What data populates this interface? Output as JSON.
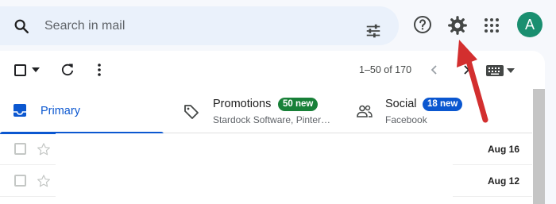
{
  "search": {
    "placeholder": "Search in mail"
  },
  "header": {
    "avatar_letter": "A"
  },
  "toolbar": {
    "pager": "1–50 of 170"
  },
  "tabs": [
    {
      "label": "Primary"
    },
    {
      "label": "Promotions",
      "badge": "50 new",
      "sub": "Stardock Software, Pinter…"
    },
    {
      "label": "Social",
      "badge": "18 new",
      "sub": "Facebook"
    }
  ],
  "rows": [
    {
      "date": "Aug 16"
    },
    {
      "date": "Aug 12"
    }
  ],
  "colors": {
    "accent": "#0b57d0",
    "promotions_badge": "#188038",
    "social_badge": "#0b57d0",
    "avatar": "#1a8f70",
    "annotation_arrow": "#d32f2f"
  },
  "icons": [
    "search-icon",
    "tune-icon",
    "help-icon",
    "gear-icon",
    "apps-icon",
    "refresh-icon",
    "more-vert-icon",
    "chevron-left-icon",
    "chevron-right-icon",
    "keyboard-icon",
    "inbox-icon",
    "tag-icon",
    "people-icon",
    "star-icon"
  ]
}
